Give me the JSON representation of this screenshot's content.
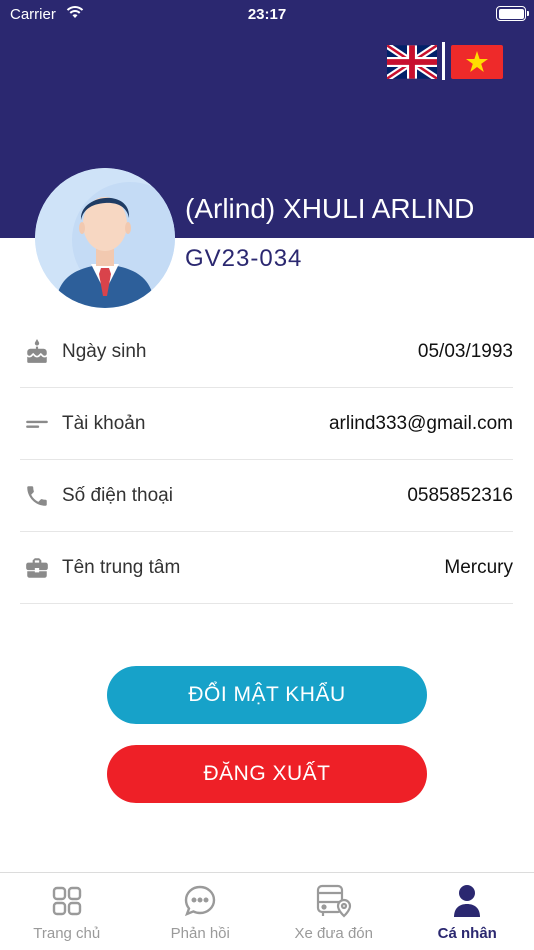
{
  "status_bar": {
    "carrier": "Carrier",
    "time": "23:17"
  },
  "colors": {
    "primary": "#2b2870",
    "change_password": "#17a2c9",
    "logout": "#ee2027"
  },
  "languages": [
    {
      "code": "en",
      "icon": "uk-flag-icon"
    },
    {
      "code": "vi",
      "icon": "vietnam-flag-icon"
    }
  ],
  "profile": {
    "name": "(Arlind) XHULI ARLIND",
    "id": "GV23-034"
  },
  "info": [
    {
      "icon": "birthday-cake-icon",
      "label": "Ngày sinh",
      "value": "05/03/1993"
    },
    {
      "icon": "account-dash-icon",
      "label": "Tài khoản",
      "value": "arlind333@gmail.com"
    },
    {
      "icon": "phone-icon",
      "label": "Số điện thoại",
      "value": "0585852316"
    },
    {
      "icon": "briefcase-icon",
      "label": "Tên trung tâm",
      "value": "Mercury"
    }
  ],
  "actions": {
    "change_password": "ĐỔI MẬT KHẨU",
    "logout": "ĐĂNG XUẤT"
  },
  "tabs": [
    {
      "label": "Trang chủ",
      "icon": "home-grid-icon",
      "active": false
    },
    {
      "label": "Phản hồi",
      "icon": "chat-bubble-icon",
      "active": false
    },
    {
      "label": "Xe đưa đón",
      "icon": "bus-location-icon",
      "active": false
    },
    {
      "label": "Cá nhân",
      "icon": "person-icon",
      "active": true
    }
  ]
}
